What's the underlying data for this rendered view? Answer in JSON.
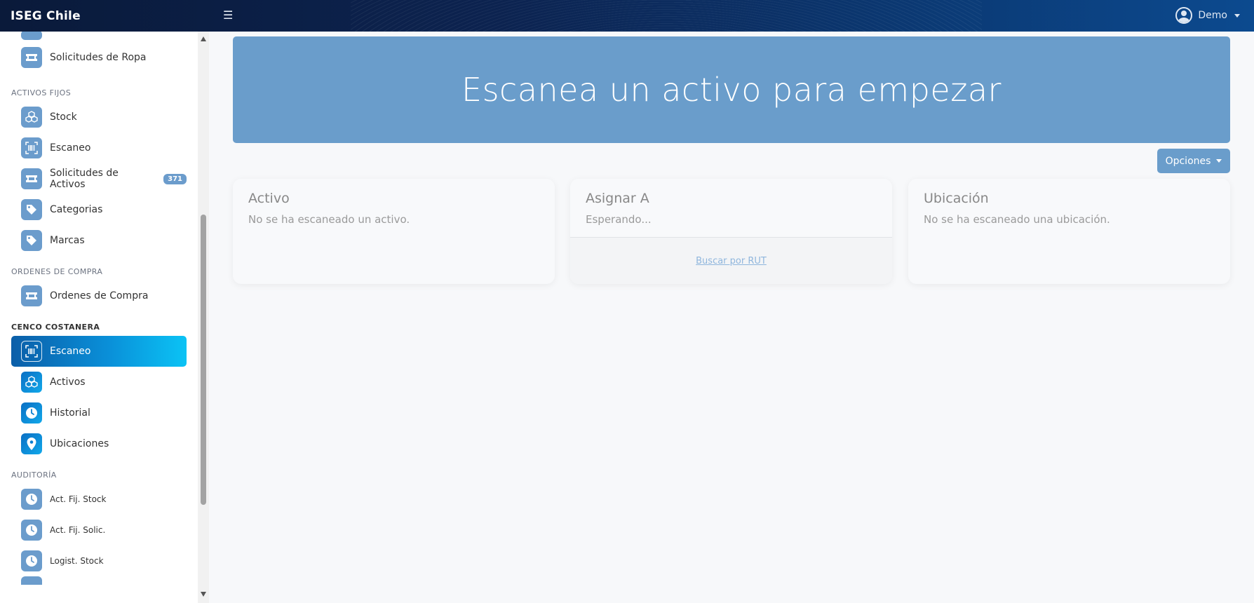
{
  "topbar": {
    "brand": "ISEG Chile",
    "menu_icon": "☰",
    "user_name": "Demo"
  },
  "sidebar": {
    "top_items": [
      {
        "label": "Solicitudes de Ropa",
        "icon": "ticket-icon"
      }
    ],
    "sections": [
      {
        "title": "ACTIVOS FIJOS",
        "items": [
          {
            "label": "Stock",
            "icon": "cubes-icon"
          },
          {
            "label": "Escaneo",
            "icon": "barcode-scan-icon"
          },
          {
            "label": "Solicitudes de Activos",
            "icon": "ticket-icon",
            "badge": "371"
          },
          {
            "label": "Categorias",
            "icon": "tag-icon"
          },
          {
            "label": "Marcas",
            "icon": "tag-icon"
          }
        ]
      },
      {
        "title": "ORDENES DE COMPRA",
        "items": [
          {
            "label": "Ordenes de Compra",
            "icon": "ticket-icon"
          }
        ]
      },
      {
        "title": "CENCO COSTANERA",
        "items": [
          {
            "label": "Escaneo",
            "icon": "barcode-scan-icon"
          },
          {
            "label": "Activos",
            "icon": "cubes-icon"
          },
          {
            "label": "Historial",
            "icon": "clock-icon"
          },
          {
            "label": "Ubicaciones",
            "icon": "map-pin-icon"
          }
        ]
      },
      {
        "title": "AUDITORÍA",
        "items": [
          {
            "label": "Act. Fij. Stock",
            "icon": "clock-icon"
          },
          {
            "label": "Act. Fij. Solic.",
            "icon": "clock-icon"
          },
          {
            "label": "Logist. Stock",
            "icon": "clock-icon"
          }
        ]
      }
    ]
  },
  "hero": {
    "title": "Escanea un activo para empezar"
  },
  "options_button": {
    "label": "Opciones"
  },
  "cards": {
    "activo": {
      "title": "Activo",
      "text": "No se ha escaneado un activo."
    },
    "asignar": {
      "title": "Asignar A",
      "text": "Esperando...",
      "link": "Buscar por RUT"
    },
    "ubicacion": {
      "title": "Ubicación",
      "text": "No se ha escaneado una ubicación."
    }
  },
  "colors": {
    "accent": "#6a9dcb",
    "active_gradient_start": "#0b5ea8",
    "active_gradient_end": "#0bc3f5"
  }
}
